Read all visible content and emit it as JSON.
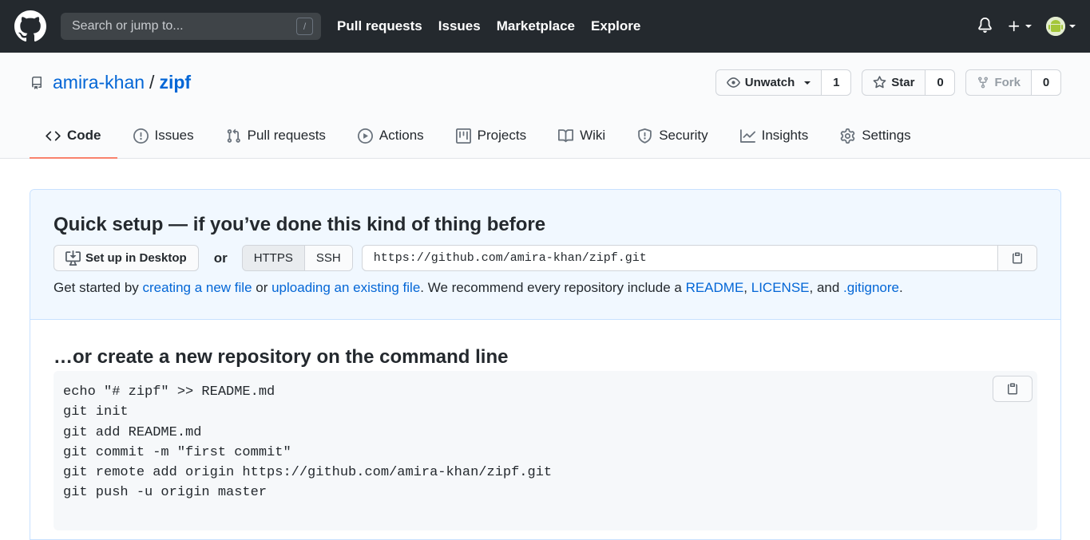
{
  "topbar": {
    "search_placeholder": "Search or jump to...",
    "search_shortcut": "/",
    "nav": [
      "Pull requests",
      "Issues",
      "Marketplace",
      "Explore"
    ]
  },
  "repo": {
    "owner": "amira-khan",
    "separator": "/",
    "name": "zipf",
    "watch": {
      "label": "Unwatch",
      "count": "1"
    },
    "star": {
      "label": "Star",
      "count": "0"
    },
    "fork": {
      "label": "Fork",
      "count": "0"
    }
  },
  "tabs": [
    {
      "label": "Code",
      "icon": "code-icon",
      "active": true
    },
    {
      "label": "Issues",
      "icon": "issue-icon"
    },
    {
      "label": "Pull requests",
      "icon": "pull-request-icon"
    },
    {
      "label": "Actions",
      "icon": "play-icon"
    },
    {
      "label": "Projects",
      "icon": "project-icon"
    },
    {
      "label": "Wiki",
      "icon": "book-icon"
    },
    {
      "label": "Security",
      "icon": "shield-icon"
    },
    {
      "label": "Insights",
      "icon": "graph-icon"
    },
    {
      "label": "Settings",
      "icon": "gear-icon"
    }
  ],
  "quick_setup": {
    "title": "Quick setup — if you’ve done this kind of thing before",
    "desktop_button": "Set up in Desktop",
    "or": "or",
    "protocols": [
      "HTTPS",
      "SSH"
    ],
    "selected_protocol": "HTTPS",
    "clone_url": "https://github.com/amira-khan/zipf.git",
    "get_started": {
      "prefix": "Get started by ",
      "link_new_file": "creating a new file",
      "middle": " or ",
      "link_upload": "uploading an existing file",
      "after_upload": ". We recommend every repository include a ",
      "link_readme": "README",
      "comma": ", ",
      "link_license": "LICENSE",
      "and": ", and ",
      "link_gitignore": ".gitignore",
      "end": "."
    }
  },
  "new_repo": {
    "title": "…or create a new repository on the command line",
    "commands": "echo \"# zipf\" >> README.md\ngit init\ngit add README.md\ngit commit -m \"first commit\"\ngit remote add origin https://github.com/amira-khan/zipf.git\ngit push -u origin master"
  },
  "colors": {
    "topbar": "#24292e",
    "link": "#0366d6",
    "active_tab_underline": "#f9826c",
    "quick_setup_bg": "#f1f8ff"
  }
}
